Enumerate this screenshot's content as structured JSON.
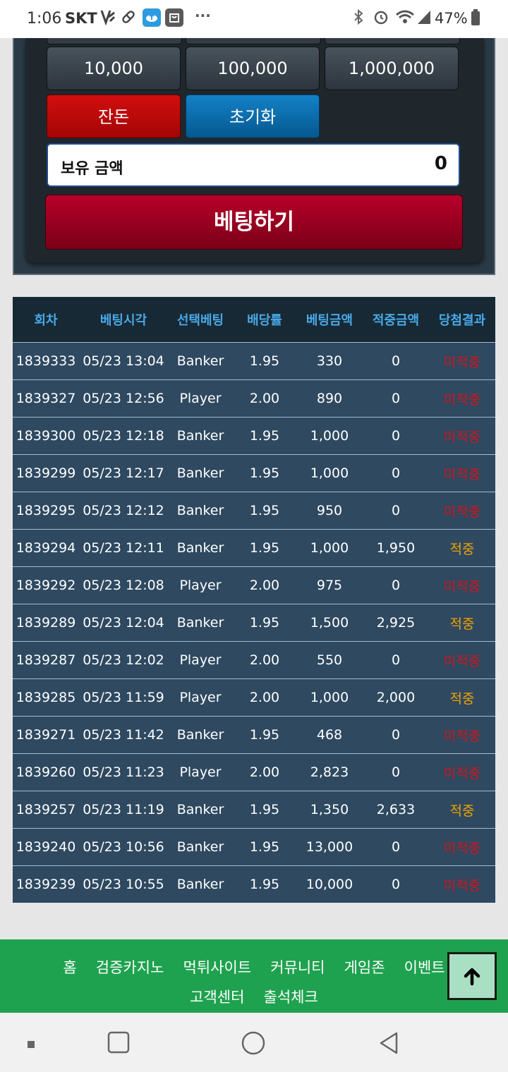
{
  "status_bar": {
    "time": "1:06",
    "carrier": "SKT",
    "battery": "47%"
  },
  "panel": {
    "chips": [
      "10,000",
      "100,000",
      "1,000,000"
    ],
    "balance_button": "잔돈",
    "reset_button": "초기화",
    "balance_label": "보유 금액",
    "balance_value": "0",
    "bet_button": "베팅하기"
  },
  "table": {
    "headers": [
      "회차",
      "베팅시각",
      "선택베팅",
      "배당률",
      "베팅금액",
      "적중금액",
      "당첨결과"
    ],
    "rows": [
      [
        "1839333",
        "05/23 13:04",
        "Banker",
        "1.95",
        "330",
        "0",
        "미적중"
      ],
      [
        "1839327",
        "05/23 12:56",
        "Player",
        "2.00",
        "890",
        "0",
        "미적중"
      ],
      [
        "1839300",
        "05/23 12:18",
        "Banker",
        "1.95",
        "1,000",
        "0",
        "미적중"
      ],
      [
        "1839299",
        "05/23 12:17",
        "Banker",
        "1.95",
        "1,000",
        "0",
        "미적중"
      ],
      [
        "1839295",
        "05/23 12:12",
        "Banker",
        "1.95",
        "950",
        "0",
        "미적중"
      ],
      [
        "1839294",
        "05/23 12:11",
        "Banker",
        "1.95",
        "1,000",
        "1,950",
        "적중"
      ],
      [
        "1839292",
        "05/23 12:08",
        "Player",
        "2.00",
        "975",
        "0",
        "미적중"
      ],
      [
        "1839289",
        "05/23 12:04",
        "Banker",
        "1.95",
        "1,500",
        "2,925",
        "적중"
      ],
      [
        "1839287",
        "05/23 12:02",
        "Player",
        "2.00",
        "550",
        "0",
        "미적중"
      ],
      [
        "1839285",
        "05/23 11:59",
        "Player",
        "2.00",
        "1,000",
        "2,000",
        "적중"
      ],
      [
        "1839271",
        "05/23 11:42",
        "Banker",
        "1.95",
        "468",
        "0",
        "미적중"
      ],
      [
        "1839260",
        "05/23 11:23",
        "Player",
        "2.00",
        "2,823",
        "0",
        "미적중"
      ],
      [
        "1839257",
        "05/23 11:19",
        "Banker",
        "1.95",
        "1,350",
        "2,633",
        "적중"
      ],
      [
        "1839240",
        "05/23 10:56",
        "Banker",
        "1.95",
        "13,000",
        "0",
        "미적중"
      ],
      [
        "1839239",
        "05/23 10:55",
        "Banker",
        "1.95",
        "10,000",
        "0",
        "미적중"
      ]
    ]
  },
  "footer": {
    "links_row1": [
      "홈",
      "검증카지노",
      "먹튀사이트",
      "커뮤니티",
      "게임존",
      "이벤트"
    ],
    "links_row2": [
      "고객센터",
      "출석체크"
    ]
  },
  "colors": {
    "win": "#f2a200",
    "lose": "#d3141d",
    "header_text": "#4aa8e8",
    "footer_bg": "#1fa24f"
  },
  "icons": {
    "scroll_top": "arrow-up-icon",
    "nav": [
      "recent-apps-icon",
      "home-icon",
      "back-icon"
    ]
  }
}
